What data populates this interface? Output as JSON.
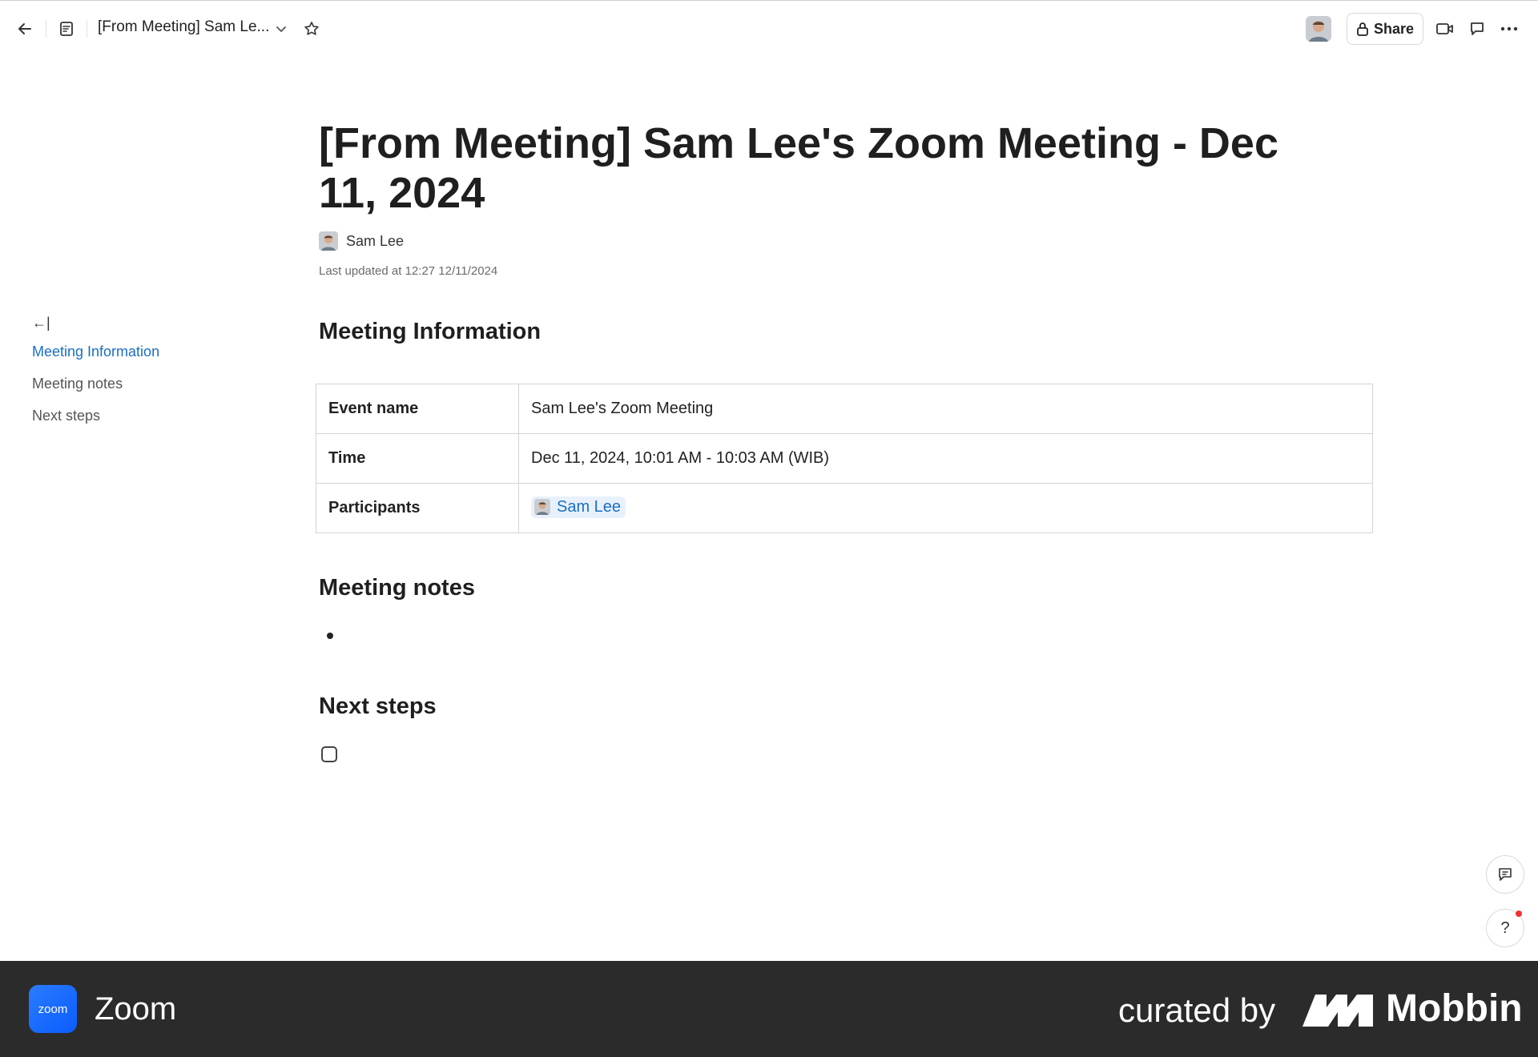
{
  "topbar": {
    "doc_title": "[From Meeting] Sam Le...",
    "share_label": "Share"
  },
  "document": {
    "title": "[From Meeting] Sam Lee's Zoom Meeting - Dec 11, 2024",
    "author": "Sam Lee",
    "last_updated": "Last updated at 12:27 12/11/2024"
  },
  "sections": {
    "meeting_information": "Meeting Information",
    "meeting_notes": "Meeting notes",
    "next_steps": "Next steps"
  },
  "info_table": {
    "rows": [
      {
        "key": "Event name",
        "value": "Sam Lee's Zoom Meeting"
      },
      {
        "key": "Time",
        "value": "Dec 11, 2024, 10:01 AM - 10:03 AM (WIB)"
      },
      {
        "key": "Participants",
        "value": "Sam Lee"
      }
    ]
  },
  "outline": {
    "collapse_icon": "←|",
    "items": [
      "Meeting Information",
      "Meeting notes",
      "Next steps"
    ]
  },
  "fab": {
    "help_label": "?"
  },
  "footer": {
    "logo_text": "zoom",
    "app_name": "Zoom",
    "curated_by": "curated by",
    "brand": "Mobbin"
  },
  "colors": {
    "accent": "#1a6fc4",
    "footer_bg": "#2b2b2b",
    "zoom_blue": "#0b5cff"
  }
}
